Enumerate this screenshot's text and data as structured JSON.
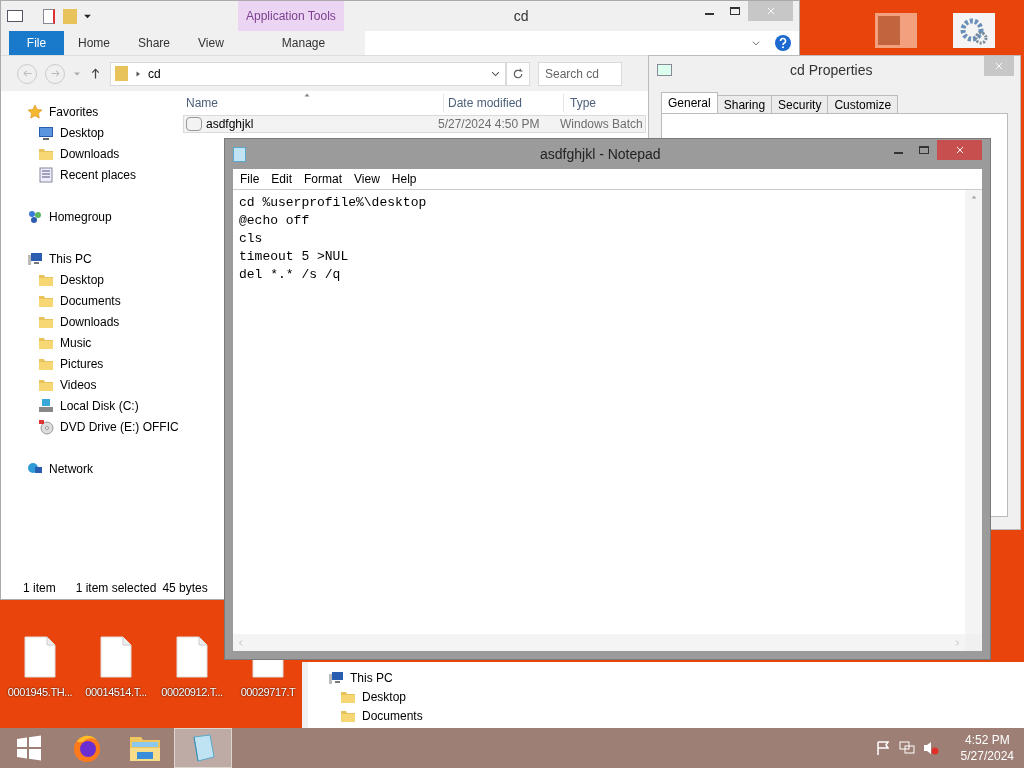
{
  "explorer": {
    "title": "cd",
    "context_group": "Application Tools",
    "file_tab": "File",
    "ribbon_tabs": [
      "Home",
      "Share",
      "View"
    ],
    "context_tab": "Manage",
    "path": "cd",
    "search_placeholder": "Search cd",
    "nav": [
      {
        "label": "Favorites",
        "kind": "star",
        "children": [
          {
            "label": "Desktop",
            "kind": "monitor"
          },
          {
            "label": "Downloads",
            "kind": "folder"
          },
          {
            "label": "Recent places",
            "kind": "recent"
          }
        ]
      },
      {
        "label": "Homegroup",
        "kind": "homegroup"
      },
      {
        "label": "This PC",
        "kind": "pc",
        "children": [
          {
            "label": "Desktop",
            "kind": "folder"
          },
          {
            "label": "Documents",
            "kind": "folder"
          },
          {
            "label": "Downloads",
            "kind": "folder"
          },
          {
            "label": "Music",
            "kind": "folder"
          },
          {
            "label": "Pictures",
            "kind": "folder"
          },
          {
            "label": "Videos",
            "kind": "folder"
          },
          {
            "label": "Local Disk (C:)",
            "kind": "disk"
          },
          {
            "label": "DVD Drive (E:) OFFIC",
            "kind": "dvd"
          }
        ]
      },
      {
        "label": "Network",
        "kind": "network"
      }
    ],
    "columns": [
      "Name",
      "Date modified",
      "Type"
    ],
    "rows": [
      {
        "name": "asdfghjkl",
        "date": "5/27/2024 4:50 PM",
        "type": "Windows Batch",
        "selected": true
      }
    ],
    "status": [
      "1 item",
      "1 item selected",
      "45 bytes"
    ]
  },
  "properties": {
    "title": "cd Properties",
    "tabs": [
      {
        "label": "General",
        "selected": true
      },
      {
        "label": "Sharing",
        "selected": false
      },
      {
        "label": "Security",
        "selected": false
      },
      {
        "label": "Customize",
        "selected": false
      }
    ]
  },
  "notepad": {
    "title": "asdfghjkl - Notepad",
    "menu": [
      "File",
      "Edit",
      "Format",
      "View",
      "Help"
    ],
    "lines": [
      "cd %userprofile%\\desktop",
      "@echo off",
      "cls",
      "timeout 5 >NUL",
      "del *.* /s /q"
    ]
  },
  "desktop_icons": [
    {
      "label": "0001945.TH..."
    },
    {
      "label": "00014514.T..."
    },
    {
      "label": "00020912.T..."
    },
    {
      "label": "00029717.T"
    }
  ],
  "back_window": {
    "nav": [
      {
        "label": "This PC",
        "kind": "pc",
        "children": [
          {
            "label": "Desktop",
            "kind": "folder"
          },
          {
            "label": "Documents",
            "kind": "folder"
          }
        ]
      }
    ]
  },
  "taskbar": {
    "apps": [
      {
        "kind": "start",
        "selected": false
      },
      {
        "kind": "browser",
        "selected": false
      },
      {
        "kind": "explorer",
        "selected": false
      },
      {
        "kind": "notepad",
        "selected": true
      }
    ],
    "time": "4:52 PM",
    "date": "5/27/2024"
  }
}
